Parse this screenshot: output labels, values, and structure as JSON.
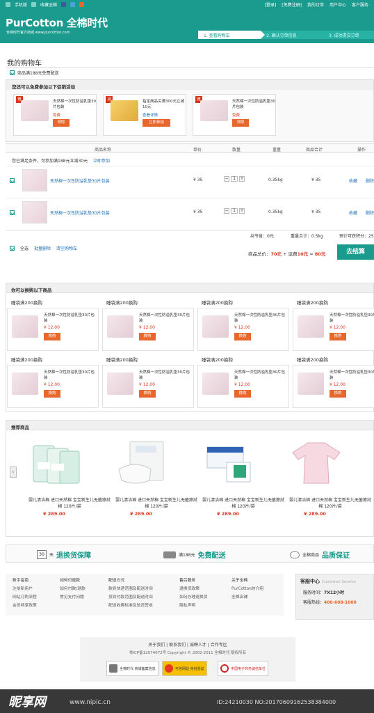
{
  "topbar": {
    "mobile": "手机版",
    "favorite": "收藏全棉",
    "login": "[登录]",
    "register": "[免费注册]",
    "orders": "我的订单",
    "user_center": "用户中心",
    "customer_service": "客户服务"
  },
  "header": {
    "logo": "PurCotton 全棉时代",
    "logo_sub": "全棉时代官方商城 www.purcotton.com",
    "steps": [
      "1. 查看购物车",
      "2. 确认订单信息",
      "3. 成功提交订单"
    ]
  },
  "cart": {
    "title": "我的购物车",
    "free_shipping": "商品满188元免费配送",
    "promo_header": "您还可以免费参加以下促销活动",
    "promos": [
      {
        "tag": "赠",
        "name": "天然棉一次性防溢乳垫30片包装",
        "status": "免费",
        "button": "领取"
      },
      {
        "tag": "减",
        "name": "指定商品买满300元立减10元",
        "status": "查看详情",
        "button": "立即参加"
      },
      {
        "tag": "赠",
        "name": "天然棉一次性防溢乳垫30片包装",
        "status": "免费",
        "button": "领取"
      }
    ],
    "columns": [
      "商品名称",
      "单价",
      "数量",
      "重量",
      "商品合计",
      "操作"
    ],
    "notice": "您已满足条件，可参加满188元立减30元",
    "notice_link": "立即参加",
    "items": [
      {
        "name": "天然棉一次性防溢乳垫30片包装",
        "price": "¥ 35",
        "qty": "1",
        "weight": "0.35kg",
        "subtotal": "¥ 35",
        "fav": "收藏",
        "del": "删除"
      },
      {
        "name": "天然棉一次性防溢乳垫30片包装",
        "price": "¥ 35",
        "qty": "1",
        "weight": "0.35kg",
        "subtotal": "¥ 35",
        "fav": "收藏",
        "del": "删除"
      }
    ],
    "saved": "共节省：0元",
    "weight_total": "重量合计：0.5kg",
    "points": "预计可获积分：25",
    "select_all": "全选",
    "batch_delete": "批量删除",
    "clear": "清空购物车",
    "total_label": "商品总价：",
    "total_goods": "70元",
    "shipping_label": " + 运费",
    "shipping": "10元",
    "eq": " = ",
    "grand_total": "80元",
    "checkout": "去结算"
  },
  "exchange": {
    "title": "你可以换购以下商品",
    "label": "睡袋满200换购",
    "product": "天然棉一次性防溢乳垫30片包装",
    "price": "¥ 12.00",
    "button": "换购"
  },
  "recommend": {
    "title": "推荐商品",
    "items": [
      {
        "name": "婴儿清洁棉 进口天然棉 宝宝新生儿无菌擦拭棉 120片/袋",
        "price": "¥ 289.00"
      },
      {
        "name": "婴儿清洁棉 进口天然棉 宝宝新生儿无菌擦拭棉 120片/袋",
        "price": "¥ 289.00"
      },
      {
        "name": "婴儿清洁棉 进口天然棉 宝宝新生儿无菌擦拭棉 120片/袋",
        "price": "¥ 289.00"
      },
      {
        "name": "婴儿清洁棉 进口天然棉 宝宝新生儿无菌擦拭棉 120片/袋",
        "price": "¥ 289.00"
      }
    ]
  },
  "guarantees": [
    {
      "icon": "30",
      "prefix": "天",
      "title": "退换货保障"
    },
    {
      "icon": "truck",
      "prefix": "满188元",
      "title": "免费配送"
    },
    {
      "icon": "chat",
      "prefix": "全棉商品",
      "title": "品质保证"
    }
  ],
  "footer": {
    "cols": [
      [
        "新手指南",
        "注册新用户",
        "网站订购流程",
        "会员特享政策"
      ],
      [
        "如何付退款",
        "如何付款/退款",
        "常见支付问题"
      ],
      [
        "配送方式",
        "款到快递范围及配送时间",
        "货到付款范围及配送时间",
        "配送收费标准及验货签收"
      ],
      [
        "售后服务",
        "退换货政策",
        "如何办理退换货",
        "隐私声明"
      ],
      [
        "关于全棉",
        "PurCotton的介绍",
        "全棉店铺"
      ]
    ],
    "service_title": "客服中心",
    "service_en": "Customer Service",
    "service_time_label": "服务时间：",
    "service_time": "7X12小时",
    "hotline_label": "客服热线：",
    "hotline": "400-608-1000",
    "links": "关于我们 | 联系我们 | 诚聘人才 | 合作专区",
    "copyright": "粤ICP备12074072号 Copyright © 2002-2011 全棉时代 版权所有",
    "badges": [
      "全棉时代 商城备案信息",
      "可信网站 身份验证",
      "中国电子商务诚信单位"
    ]
  },
  "watermark": {
    "logo": "昵享网",
    "url": "www.nipic.cn",
    "id": "ID:24210030 NO:20170609162538384000"
  },
  "colors": {
    "brand": "#1b9a8e",
    "accent": "#e8672c",
    "price": "#d9361e",
    "link": "#1f6fb8"
  }
}
